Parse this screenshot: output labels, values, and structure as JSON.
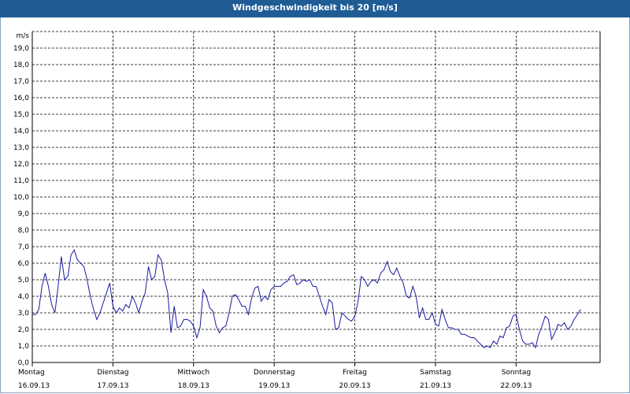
{
  "window": {
    "title": "Windgeschwindigkeit bis 20 [m/s]"
  },
  "chart_data": {
    "type": "line",
    "title": "Windgeschwindigkeit bis 20 [m/s]",
    "ylabel": "m/s",
    "xlabel": "",
    "ylim": [
      0,
      20
    ],
    "y_ticks": [
      "0,0",
      "1,0",
      "2,0",
      "3,0",
      "4,0",
      "5,0",
      "6,0",
      "7,0",
      "8,0",
      "9,0",
      "10,0",
      "11,0",
      "12,0",
      "13,0",
      "14,0",
      "15,0",
      "16,0",
      "17,0",
      "18,0",
      "19,0"
    ],
    "days": [
      {
        "name": "Montag",
        "date": "16.09.13"
      },
      {
        "name": "Dienstag",
        "date": "17.09.13"
      },
      {
        "name": "Mittwoch",
        "date": "18.09.13"
      },
      {
        "name": "Donnerstag",
        "date": "19.09.13"
      },
      {
        "name": "Freitag",
        "date": "20.09.13"
      },
      {
        "name": "Samstag",
        "date": "21.09.13"
      },
      {
        "name": "Sonntag",
        "date": "22.09.13"
      }
    ],
    "grid": true,
    "line_color": "#1a1aa0",
    "series": [
      {
        "x_unit": "days since Montag 16.09.13 00:00",
        "points": [
          [
            0.0,
            2.9
          ],
          [
            0.04,
            2.9
          ],
          [
            0.08,
            3.2
          ],
          [
            0.12,
            4.6
          ],
          [
            0.16,
            5.4
          ],
          [
            0.2,
            4.6
          ],
          [
            0.24,
            3.5
          ],
          [
            0.28,
            3.0
          ],
          [
            0.32,
            4.6
          ],
          [
            0.36,
            6.4
          ],
          [
            0.4,
            5.0
          ],
          [
            0.44,
            5.2
          ],
          [
            0.48,
            6.5
          ],
          [
            0.52,
            6.8
          ],
          [
            0.56,
            6.2
          ],
          [
            0.6,
            6.0
          ],
          [
            0.64,
            5.8
          ],
          [
            0.68,
            5.0
          ],
          [
            0.72,
            4.0
          ],
          [
            0.76,
            3.2
          ],
          [
            0.8,
            2.6
          ],
          [
            0.84,
            3.0
          ],
          [
            0.88,
            3.6
          ],
          [
            0.92,
            4.2
          ],
          [
            0.96,
            4.8
          ],
          [
            1.0,
            3.4
          ],
          [
            1.04,
            3.0
          ],
          [
            1.08,
            3.3
          ],
          [
            1.12,
            3.1
          ],
          [
            1.16,
            3.5
          ],
          [
            1.2,
            3.3
          ],
          [
            1.24,
            4.0
          ],
          [
            1.28,
            3.6
          ],
          [
            1.32,
            3.0
          ],
          [
            1.36,
            3.7
          ],
          [
            1.4,
            4.2
          ],
          [
            1.44,
            5.8
          ],
          [
            1.48,
            5.0
          ],
          [
            1.52,
            5.2
          ],
          [
            1.56,
            6.5
          ],
          [
            1.6,
            6.2
          ],
          [
            1.64,
            5.0
          ],
          [
            1.68,
            4.2
          ],
          [
            1.72,
            1.8
          ],
          [
            1.76,
            3.4
          ],
          [
            1.8,
            2.1
          ],
          [
            1.84,
            2.2
          ],
          [
            1.88,
            2.6
          ],
          [
            1.92,
            2.6
          ],
          [
            1.96,
            2.5
          ],
          [
            2.0,
            2.2
          ],
          [
            2.04,
            1.5
          ],
          [
            2.08,
            2.1
          ],
          [
            2.12,
            4.4
          ],
          [
            2.16,
            4.0
          ],
          [
            2.2,
            3.3
          ],
          [
            2.24,
            3.1
          ],
          [
            2.28,
            2.2
          ],
          [
            2.32,
            1.8
          ],
          [
            2.36,
            2.1
          ],
          [
            2.4,
            2.2
          ],
          [
            2.44,
            3.0
          ],
          [
            2.48,
            4.0
          ],
          [
            2.52,
            4.1
          ],
          [
            2.56,
            3.8
          ],
          [
            2.6,
            3.4
          ],
          [
            2.64,
            3.4
          ],
          [
            2.68,
            2.9
          ],
          [
            2.72,
            3.9
          ],
          [
            2.76,
            4.5
          ],
          [
            2.8,
            4.6
          ],
          [
            2.84,
            3.7
          ],
          [
            2.88,
            4.0
          ],
          [
            2.92,
            3.8
          ],
          [
            2.96,
            4.4
          ],
          [
            3.0,
            4.6
          ],
          [
            3.04,
            4.6
          ],
          [
            3.08,
            4.6
          ],
          [
            3.12,
            4.8
          ],
          [
            3.16,
            4.9
          ],
          [
            3.2,
            5.2
          ],
          [
            3.24,
            5.3
          ],
          [
            3.28,
            4.7
          ],
          [
            3.32,
            4.8
          ],
          [
            3.36,
            5.0
          ],
          [
            3.4,
            4.9
          ],
          [
            3.44,
            5.0
          ],
          [
            3.48,
            4.6
          ],
          [
            3.52,
            4.6
          ],
          [
            3.56,
            4.0
          ],
          [
            3.6,
            3.4
          ],
          [
            3.64,
            2.9
          ],
          [
            3.68,
            3.8
          ],
          [
            3.72,
            3.6
          ],
          [
            3.76,
            2.0
          ],
          [
            3.8,
            2.1
          ],
          [
            3.84,
            3.0
          ],
          [
            3.88,
            2.8
          ],
          [
            3.92,
            2.6
          ],
          [
            3.96,
            2.5
          ],
          [
            4.0,
            2.8
          ],
          [
            4.04,
            3.7
          ],
          [
            4.08,
            5.2
          ],
          [
            4.12,
            5.0
          ],
          [
            4.16,
            4.6
          ],
          [
            4.2,
            4.9
          ],
          [
            4.24,
            5.0
          ],
          [
            4.28,
            4.8
          ],
          [
            4.32,
            5.4
          ],
          [
            4.36,
            5.6
          ],
          [
            4.4,
            6.1
          ],
          [
            4.44,
            5.5
          ],
          [
            4.48,
            5.3
          ],
          [
            4.52,
            5.7
          ],
          [
            4.56,
            5.2
          ],
          [
            4.6,
            4.8
          ],
          [
            4.64,
            4.0
          ],
          [
            4.68,
            3.9
          ],
          [
            4.72,
            4.6
          ],
          [
            4.76,
            4.0
          ],
          [
            4.8,
            2.7
          ],
          [
            4.84,
            3.3
          ],
          [
            4.88,
            2.6
          ],
          [
            4.92,
            2.6
          ],
          [
            4.96,
            3.0
          ],
          [
            5.0,
            2.3
          ],
          [
            5.04,
            2.2
          ],
          [
            5.08,
            3.2
          ],
          [
            5.12,
            2.6
          ],
          [
            5.16,
            2.1
          ],
          [
            5.2,
            2.1
          ],
          [
            5.24,
            2.0
          ],
          [
            5.28,
            2.0
          ],
          [
            5.32,
            1.7
          ],
          [
            5.36,
            1.7
          ],
          [
            5.4,
            1.6
          ],
          [
            5.44,
            1.5
          ],
          [
            5.48,
            1.5
          ],
          [
            5.52,
            1.3
          ],
          [
            5.56,
            1.1
          ],
          [
            5.6,
            0.9
          ],
          [
            5.64,
            1.0
          ],
          [
            5.68,
            0.9
          ],
          [
            5.72,
            1.3
          ],
          [
            5.76,
            1.1
          ],
          [
            5.8,
            1.6
          ],
          [
            5.84,
            1.5
          ],
          [
            5.88,
            2.1
          ],
          [
            5.92,
            2.2
          ],
          [
            5.96,
            2.8
          ],
          [
            6.0,
            2.9
          ],
          [
            6.04,
            2.0
          ],
          [
            6.08,
            1.3
          ],
          [
            6.12,
            1.1
          ],
          [
            6.16,
            1.1
          ],
          [
            6.2,
            1.2
          ],
          [
            6.24,
            0.9
          ],
          [
            6.28,
            1.7
          ],
          [
            6.32,
            2.2
          ],
          [
            6.36,
            2.8
          ],
          [
            6.4,
            2.6
          ],
          [
            6.44,
            1.4
          ],
          [
            6.48,
            1.8
          ],
          [
            6.52,
            2.3
          ],
          [
            6.56,
            2.2
          ],
          [
            6.6,
            2.4
          ],
          [
            6.64,
            2.0
          ],
          [
            6.68,
            2.2
          ],
          [
            6.72,
            2.6
          ],
          [
            6.76,
            2.9
          ],
          [
            6.8,
            3.2
          ]
        ]
      }
    ]
  }
}
